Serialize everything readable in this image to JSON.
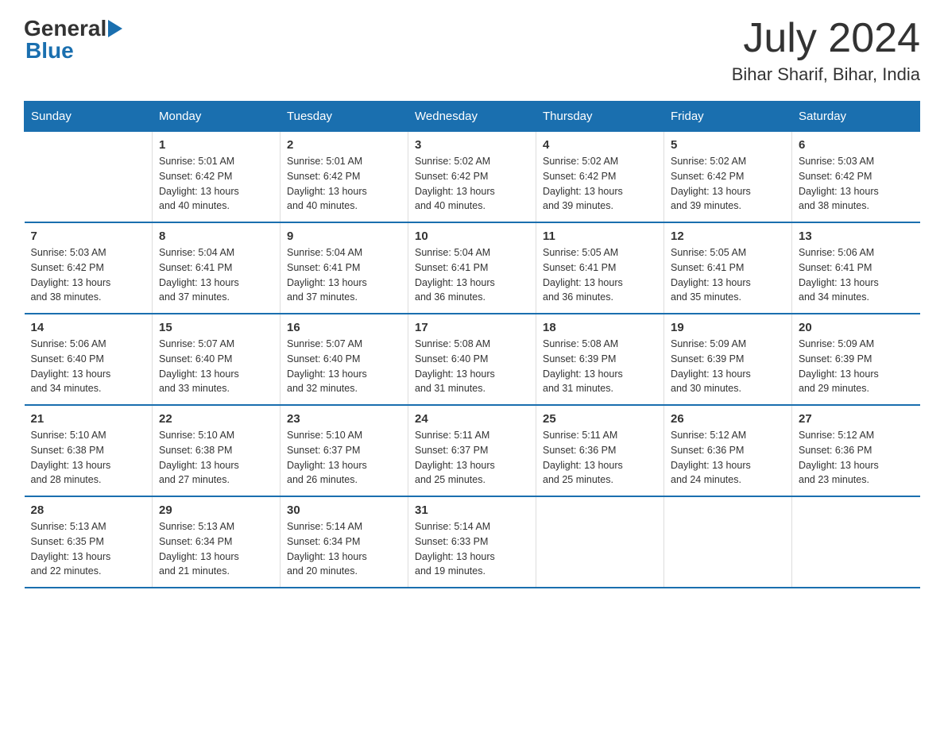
{
  "logo": {
    "general": "General",
    "blue": "Blue"
  },
  "title": {
    "month": "July 2024",
    "location": "Bihar Sharif, Bihar, India"
  },
  "colors": {
    "header_bg": "#1a6faf",
    "header_text": "#ffffff"
  },
  "weekdays": [
    "Sunday",
    "Monday",
    "Tuesday",
    "Wednesday",
    "Thursday",
    "Friday",
    "Saturday"
  ],
  "weeks": [
    [
      {
        "day": "",
        "info": ""
      },
      {
        "day": "1",
        "info": "Sunrise: 5:01 AM\nSunset: 6:42 PM\nDaylight: 13 hours\nand 40 minutes."
      },
      {
        "day": "2",
        "info": "Sunrise: 5:01 AM\nSunset: 6:42 PM\nDaylight: 13 hours\nand 40 minutes."
      },
      {
        "day": "3",
        "info": "Sunrise: 5:02 AM\nSunset: 6:42 PM\nDaylight: 13 hours\nand 40 minutes."
      },
      {
        "day": "4",
        "info": "Sunrise: 5:02 AM\nSunset: 6:42 PM\nDaylight: 13 hours\nand 39 minutes."
      },
      {
        "day": "5",
        "info": "Sunrise: 5:02 AM\nSunset: 6:42 PM\nDaylight: 13 hours\nand 39 minutes."
      },
      {
        "day": "6",
        "info": "Sunrise: 5:03 AM\nSunset: 6:42 PM\nDaylight: 13 hours\nand 38 minutes."
      }
    ],
    [
      {
        "day": "7",
        "info": "Sunrise: 5:03 AM\nSunset: 6:42 PM\nDaylight: 13 hours\nand 38 minutes."
      },
      {
        "day": "8",
        "info": "Sunrise: 5:04 AM\nSunset: 6:41 PM\nDaylight: 13 hours\nand 37 minutes."
      },
      {
        "day": "9",
        "info": "Sunrise: 5:04 AM\nSunset: 6:41 PM\nDaylight: 13 hours\nand 37 minutes."
      },
      {
        "day": "10",
        "info": "Sunrise: 5:04 AM\nSunset: 6:41 PM\nDaylight: 13 hours\nand 36 minutes."
      },
      {
        "day": "11",
        "info": "Sunrise: 5:05 AM\nSunset: 6:41 PM\nDaylight: 13 hours\nand 36 minutes."
      },
      {
        "day": "12",
        "info": "Sunrise: 5:05 AM\nSunset: 6:41 PM\nDaylight: 13 hours\nand 35 minutes."
      },
      {
        "day": "13",
        "info": "Sunrise: 5:06 AM\nSunset: 6:41 PM\nDaylight: 13 hours\nand 34 minutes."
      }
    ],
    [
      {
        "day": "14",
        "info": "Sunrise: 5:06 AM\nSunset: 6:40 PM\nDaylight: 13 hours\nand 34 minutes."
      },
      {
        "day": "15",
        "info": "Sunrise: 5:07 AM\nSunset: 6:40 PM\nDaylight: 13 hours\nand 33 minutes."
      },
      {
        "day": "16",
        "info": "Sunrise: 5:07 AM\nSunset: 6:40 PM\nDaylight: 13 hours\nand 32 minutes."
      },
      {
        "day": "17",
        "info": "Sunrise: 5:08 AM\nSunset: 6:40 PM\nDaylight: 13 hours\nand 31 minutes."
      },
      {
        "day": "18",
        "info": "Sunrise: 5:08 AM\nSunset: 6:39 PM\nDaylight: 13 hours\nand 31 minutes."
      },
      {
        "day": "19",
        "info": "Sunrise: 5:09 AM\nSunset: 6:39 PM\nDaylight: 13 hours\nand 30 minutes."
      },
      {
        "day": "20",
        "info": "Sunrise: 5:09 AM\nSunset: 6:39 PM\nDaylight: 13 hours\nand 29 minutes."
      }
    ],
    [
      {
        "day": "21",
        "info": "Sunrise: 5:10 AM\nSunset: 6:38 PM\nDaylight: 13 hours\nand 28 minutes."
      },
      {
        "day": "22",
        "info": "Sunrise: 5:10 AM\nSunset: 6:38 PM\nDaylight: 13 hours\nand 27 minutes."
      },
      {
        "day": "23",
        "info": "Sunrise: 5:10 AM\nSunset: 6:37 PM\nDaylight: 13 hours\nand 26 minutes."
      },
      {
        "day": "24",
        "info": "Sunrise: 5:11 AM\nSunset: 6:37 PM\nDaylight: 13 hours\nand 25 minutes."
      },
      {
        "day": "25",
        "info": "Sunrise: 5:11 AM\nSunset: 6:36 PM\nDaylight: 13 hours\nand 25 minutes."
      },
      {
        "day": "26",
        "info": "Sunrise: 5:12 AM\nSunset: 6:36 PM\nDaylight: 13 hours\nand 24 minutes."
      },
      {
        "day": "27",
        "info": "Sunrise: 5:12 AM\nSunset: 6:36 PM\nDaylight: 13 hours\nand 23 minutes."
      }
    ],
    [
      {
        "day": "28",
        "info": "Sunrise: 5:13 AM\nSunset: 6:35 PM\nDaylight: 13 hours\nand 22 minutes."
      },
      {
        "day": "29",
        "info": "Sunrise: 5:13 AM\nSunset: 6:34 PM\nDaylight: 13 hours\nand 21 minutes."
      },
      {
        "day": "30",
        "info": "Sunrise: 5:14 AM\nSunset: 6:34 PM\nDaylight: 13 hours\nand 20 minutes."
      },
      {
        "day": "31",
        "info": "Sunrise: 5:14 AM\nSunset: 6:33 PM\nDaylight: 13 hours\nand 19 minutes."
      },
      {
        "day": "",
        "info": ""
      },
      {
        "day": "",
        "info": ""
      },
      {
        "day": "",
        "info": ""
      }
    ]
  ]
}
